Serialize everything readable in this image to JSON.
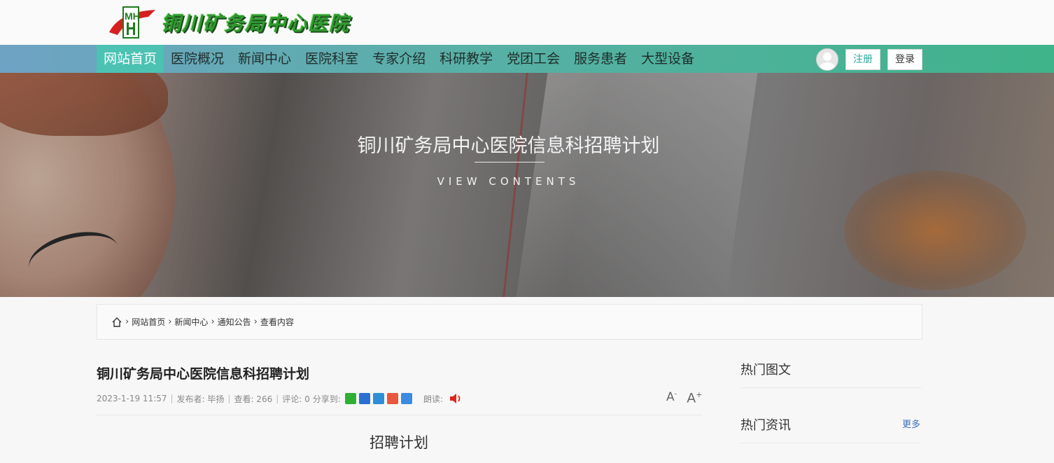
{
  "site": {
    "name": "铜川矿务局中心医院",
    "logo_letters": "MH"
  },
  "nav": {
    "items": [
      "网站首页",
      "医院概况",
      "新闻中心",
      "医院科室",
      "专家介绍",
      "科研教学",
      "党团工会",
      "服务患者",
      "大型设备"
    ],
    "active": 0,
    "register_label": "注册",
    "login_label": "登录"
  },
  "banner": {
    "title": "铜川矿务局中心医院信息科招聘计划",
    "subtitle": "VIEW CONTENTS"
  },
  "breadcrumb": [
    "网站首页",
    "新闻中心",
    "通知公告",
    "查看内容"
  ],
  "article": {
    "title": "铜川矿务局中心医院信息科招聘计划",
    "date": "2023-1-19 11:57",
    "publisher": "发布者: 毕扬",
    "views": "查看: 266",
    "comments": "评论: 0",
    "share_label": "分享到:",
    "read_label": "朗读:",
    "font_smaller": "A",
    "font_larger": "A",
    "content_heading": "招聘计划"
  },
  "sidebar": {
    "hot_images": "热门图文",
    "hot_news": "热门资讯",
    "more": "更多"
  },
  "colors": {
    "nav_active": "#4cc2b3",
    "accent": "#2aa79b",
    "link": "#3b6fb6"
  }
}
